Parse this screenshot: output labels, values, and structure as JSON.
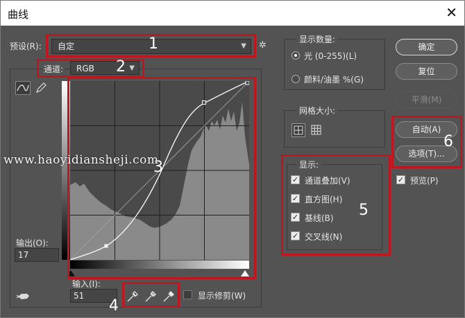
{
  "window": {
    "title": "曲线",
    "close_glyph": "✕"
  },
  "preset": {
    "label": "预设(R):",
    "value": "自定"
  },
  "channel": {
    "label": "通道:",
    "value": "RGB"
  },
  "display_amount": {
    "title": "显示数量:",
    "options": [
      {
        "label": "光 (0-255)(L)",
        "selected": true
      },
      {
        "label": "颜料/油墨 %(G)",
        "selected": false
      }
    ]
  },
  "grid_size": {
    "title": "网格大小:"
  },
  "show": {
    "title": "显示:",
    "items": [
      {
        "label": "通道叠加(V)",
        "checked": true
      },
      {
        "label": "直方图(H)",
        "checked": true
      },
      {
        "label": "基线(B)",
        "checked": true
      },
      {
        "label": "交叉线(N)",
        "checked": true
      }
    ]
  },
  "buttons": {
    "ok": "确定",
    "reset": "复位",
    "smooth": "平滑(M)",
    "auto": "自动(A)",
    "options": "选项(T)..."
  },
  "preview": {
    "label": "预览(P)",
    "checked": true
  },
  "output": {
    "label": "输出(O):",
    "value": "17"
  },
  "input": {
    "label": "输入(I):",
    "value": "51"
  },
  "show_clipping": {
    "label": "显示修剪(W)",
    "checked": false
  },
  "annotations": [
    "1",
    "2",
    "3",
    "4",
    "5",
    "6"
  ],
  "watermark": "www.haoyidiansheji.com",
  "icons": {
    "gear": "gear-icon",
    "curve_tool": "curve-tool-icon",
    "pencil": "pencil-icon",
    "hand": "target-adjust-hand-icon",
    "eyedroppers": [
      "black-point-eyedropper-icon",
      "gray-point-eyedropper-icon",
      "white-point-eyedropper-icon"
    ]
  },
  "colors": {
    "annotation_red": "#c0161f",
    "panel_bg": "#535353",
    "graph_bg": "#4a4a4a",
    "histogram": "#8a8a8a"
  },
  "curve_points": [
    {
      "input": 0,
      "output": 0
    },
    {
      "input": 51,
      "output": 17
    },
    {
      "input": 195,
      "output": 226
    },
    {
      "input": 255,
      "output": 255
    }
  ]
}
